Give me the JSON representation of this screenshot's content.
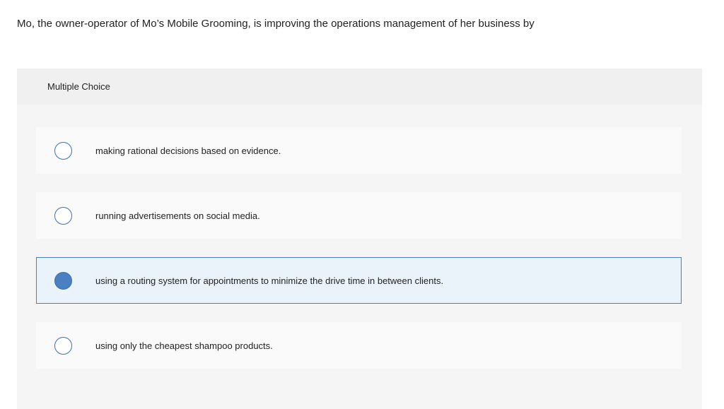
{
  "question": {
    "text": "Mo, the owner-operator of Mo’s Mobile Grooming, is improving the operations management of her business by"
  },
  "panel": {
    "type_label": "Multiple Choice"
  },
  "options": [
    {
      "label": "making rational decisions based on evidence.",
      "selected": false
    },
    {
      "label": "running advertisements on social media.",
      "selected": false
    },
    {
      "label": "using a routing system for appointments to minimize the drive time in between clients.",
      "selected": true
    },
    {
      "label": "using only the cheapest shampoo products.",
      "selected": false
    }
  ],
  "colors": {
    "accent": "#4a7fc1",
    "selected_bg": "#ebf3fa",
    "panel_bg": "#f5f5f5"
  }
}
